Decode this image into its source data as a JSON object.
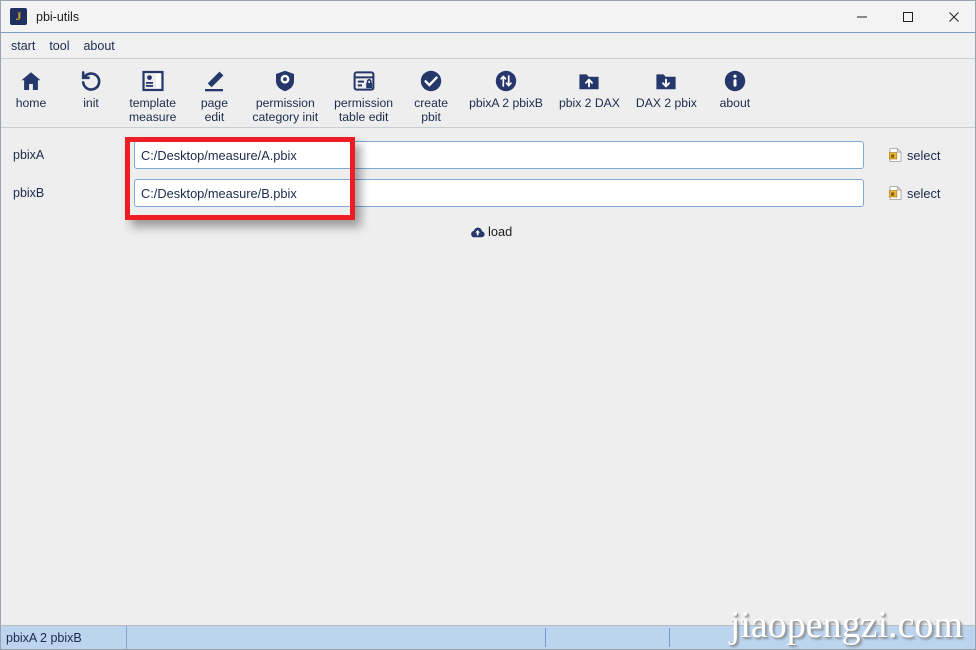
{
  "window": {
    "title": "pbi-utils",
    "app_icon_letter": "J",
    "controls": [
      {
        "name": "minimize",
        "glyph": "─"
      },
      {
        "name": "maximize",
        "glyph": "□"
      },
      {
        "name": "close",
        "glyph": "✕"
      }
    ]
  },
  "menubar": {
    "items": [
      {
        "label": "start"
      },
      {
        "label": "tool"
      },
      {
        "label": "about"
      }
    ]
  },
  "toolbar": {
    "buttons": [
      {
        "label": "home",
        "icon": "home-icon"
      },
      {
        "label": "init",
        "icon": "refresh-icon"
      },
      {
        "label": "template\nmeasure",
        "icon": "template-panel-icon"
      },
      {
        "label": "page\nedit",
        "icon": "pencil-icon"
      },
      {
        "label": "permission\ncategory init",
        "icon": "shield-gear-icon"
      },
      {
        "label": "permission\ntable edit",
        "icon": "table-lock-icon"
      },
      {
        "label": "create\npbit",
        "icon": "check-circle-icon"
      },
      {
        "label": "pbixA 2 pbixB",
        "icon": "updown-arrows-circle-icon"
      },
      {
        "label": "pbix 2 DAX",
        "icon": "folder-up-icon"
      },
      {
        "label": "DAX 2 pbix",
        "icon": "folder-down-icon"
      },
      {
        "label": "about",
        "icon": "info-circle-icon"
      }
    ]
  },
  "form": {
    "rows": [
      {
        "label": "pbixA",
        "value": "C:/Desktop/measure/A.pbix",
        "placeholder": "",
        "select_label": "select"
      },
      {
        "label": "pbixB",
        "value": "C:/Desktop/measure/B.pbix",
        "placeholder": "",
        "select_label": "select"
      }
    ],
    "load_label": "load"
  },
  "statusbar": {
    "text": "pbixA 2 pbixB"
  },
  "watermark": {
    "text": "jiaopengzi.com"
  },
  "colors": {
    "accent_navy": "#25376b",
    "annotation_red": "#ee1c25",
    "status_blue": "#bcd4ee",
    "input_border": "#7fa8d4",
    "icon_gold": "#d9a72c"
  }
}
